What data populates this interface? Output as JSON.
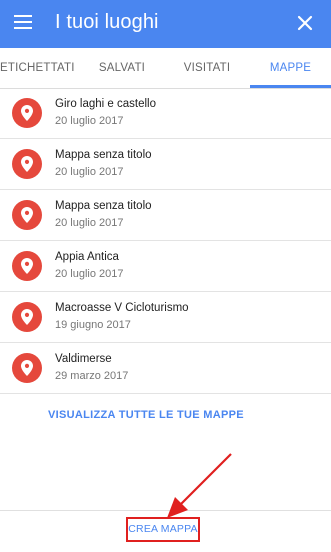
{
  "appbar": {
    "title": "I tuoi luoghi",
    "color": "#4a86f0"
  },
  "tabs": [
    {
      "label": "ETICHETTATI",
      "active": false
    },
    {
      "label": "SALVATI",
      "active": false
    },
    {
      "label": "VISITATI",
      "active": false
    },
    {
      "label": "MAPPE",
      "active": true
    }
  ],
  "maps": [
    {
      "title": "Giro laghi e castello",
      "date": "20 luglio 2017"
    },
    {
      "title": "Mappa senza titolo",
      "date": "20 luglio 2017"
    },
    {
      "title": "Mappa senza titolo",
      "date": "20 luglio 2017"
    },
    {
      "title": "Appia Antica",
      "date": "20 luglio 2017"
    },
    {
      "title": "Macroasse V Cicloturismo",
      "date": "19 giugno 2017"
    },
    {
      "title": "Valdimerse",
      "date": "29 marzo 2017"
    }
  ],
  "view_all_label": "VISUALIZZA TUTTE LE TUE MAPPE",
  "create_map_label": "CREA MAPPA",
  "colors": {
    "pin": "#e5483c",
    "annotation": "#e0201f"
  },
  "icons": {
    "menu": "menu-icon",
    "close": "close-icon",
    "pin": "place-pin-icon"
  }
}
